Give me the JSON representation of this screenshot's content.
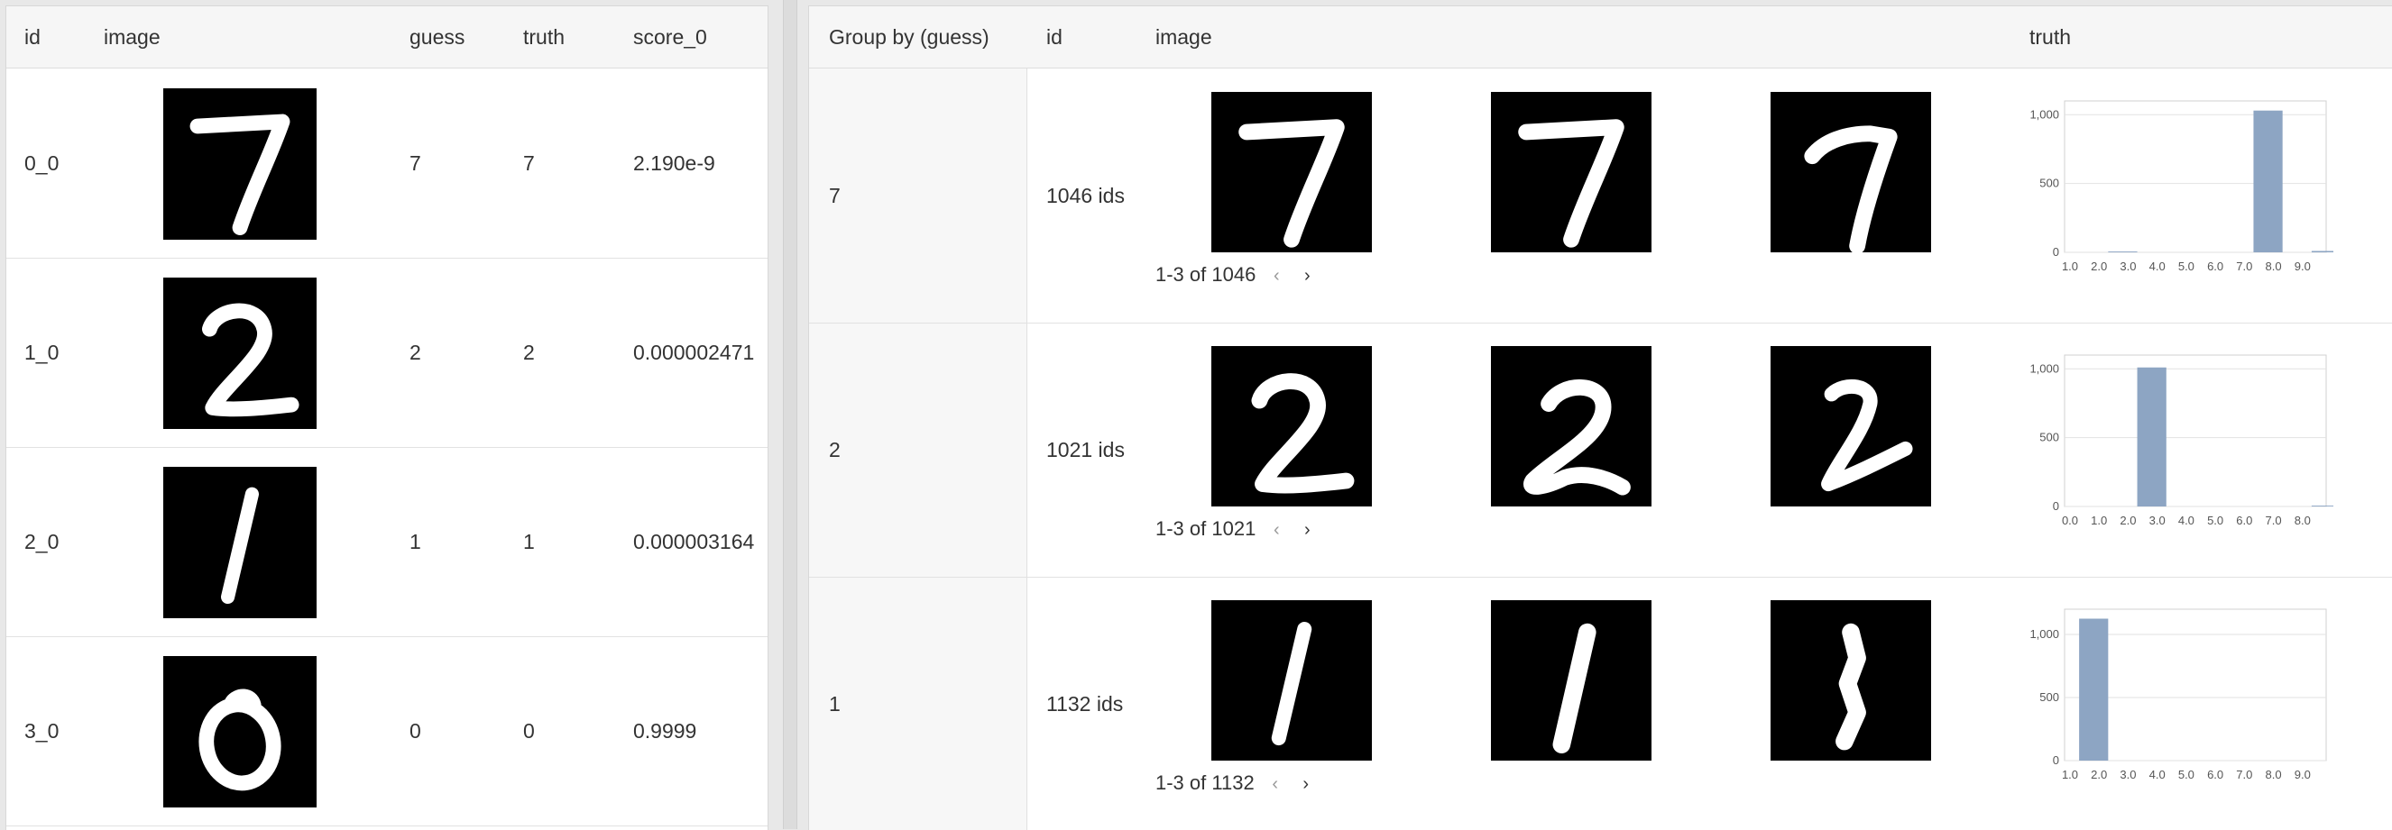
{
  "left_table": {
    "headers": {
      "id": "id",
      "image": "image",
      "guess": "guess",
      "truth": "truth",
      "score": "score_0"
    },
    "rows": [
      {
        "id": "0_0",
        "digit": "7",
        "guess": "7",
        "truth": "7",
        "score": "2.190e-9"
      },
      {
        "id": "1_0",
        "digit": "2",
        "guess": "2",
        "truth": "2",
        "score": "0.000002471"
      },
      {
        "id": "2_0",
        "digit": "1",
        "guess": "1",
        "truth": "1",
        "score": "0.000003164"
      },
      {
        "id": "3_0",
        "digit": "0",
        "guess": "0",
        "truth": "0",
        "score": "0.9999"
      }
    ]
  },
  "right_table": {
    "headers": {
      "group": "Group by (guess)",
      "id": "id",
      "image": "image",
      "truth": "truth"
    },
    "groups": [
      {
        "group": "7",
        "ids": "1046 ids",
        "pager": "1-3 of 1046",
        "digits": [
          "7",
          "7",
          "7b"
        ]
      },
      {
        "group": "2",
        "ids": "1021 ids",
        "pager": "1-3 of 1021",
        "digits": [
          "2",
          "2b",
          "2c"
        ]
      },
      {
        "group": "1",
        "ids": "1132 ids",
        "pager": "1-3 of 1132",
        "digits": [
          "1",
          "1b",
          "1c"
        ]
      }
    ]
  },
  "icons": {
    "prev": "chevron-left-icon",
    "next": "chevron-right-icon"
  },
  "colors": {
    "bar": "#8da5c3",
    "header_bg": "#f6f6f6",
    "group_bg": "#f7f7f7"
  },
  "chart_data": [
    {
      "type": "bar",
      "title": "",
      "xlabel": "",
      "ylabel": "",
      "categories": [
        "1.0",
        "2.0",
        "3.0",
        "4.0",
        "5.0",
        "6.0",
        "7.0",
        "8.0",
        "9.0"
      ],
      "values": [
        0,
        6,
        0,
        0,
        0,
        0,
        1030,
        0,
        10
      ],
      "ylim": [
        0,
        1100
      ],
      "yticks": [
        "0",
        "500",
        "1,000"
      ],
      "grid": true
    },
    {
      "type": "bar",
      "title": "",
      "xlabel": "",
      "ylabel": "",
      "categories": [
        "0.0",
        "1.0",
        "2.0",
        "3.0",
        "4.0",
        "5.0",
        "6.0",
        "7.0",
        "8.0"
      ],
      "values": [
        0,
        0,
        1010,
        0,
        0,
        0,
        0,
        0,
        6
      ],
      "ylim": [
        0,
        1100
      ],
      "yticks": [
        "0",
        "500",
        "1,000"
      ],
      "grid": true
    },
    {
      "type": "bar",
      "title": "",
      "xlabel": "",
      "ylabel": "",
      "categories": [
        "1.0",
        "2.0",
        "3.0",
        "4.0",
        "5.0",
        "6.0",
        "7.0",
        "8.0",
        "9.0"
      ],
      "values": [
        1125,
        0,
        0,
        0,
        0,
        0,
        0,
        0,
        0
      ],
      "ylim": [
        0,
        1200
      ],
      "yticks": [
        "0",
        "500",
        "1,000"
      ],
      "grid": true
    }
  ]
}
